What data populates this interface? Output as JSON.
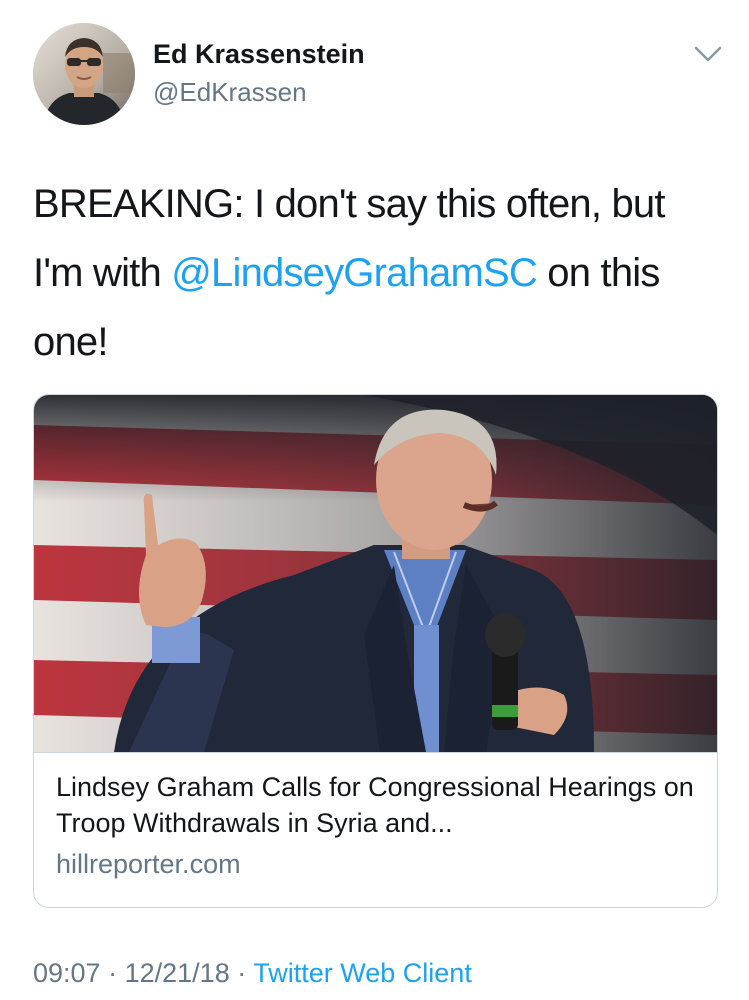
{
  "tweet": {
    "author": {
      "display_name": "Ed Krassenstein",
      "handle": "@EdKrassen"
    },
    "text_before": "BREAKING:  I don't say this often, but I'm with ",
    "mention": "@LindseyGrahamSC",
    "text_after": " on this one!",
    "card": {
      "title": "Lindsey Graham Calls for Congressional Hearings on Troop Withdrawals in Syria and...",
      "domain": "hillreporter.com"
    },
    "time": "09:07",
    "separator": "·",
    "date": "12/21/18",
    "source": "Twitter Web Client"
  },
  "icons": {
    "menu": "chevron-down-icon"
  },
  "colors": {
    "link": "#1da1f2",
    "secondary_text": "#657786",
    "primary_text": "#14171a",
    "border": "#ccd6dd"
  }
}
